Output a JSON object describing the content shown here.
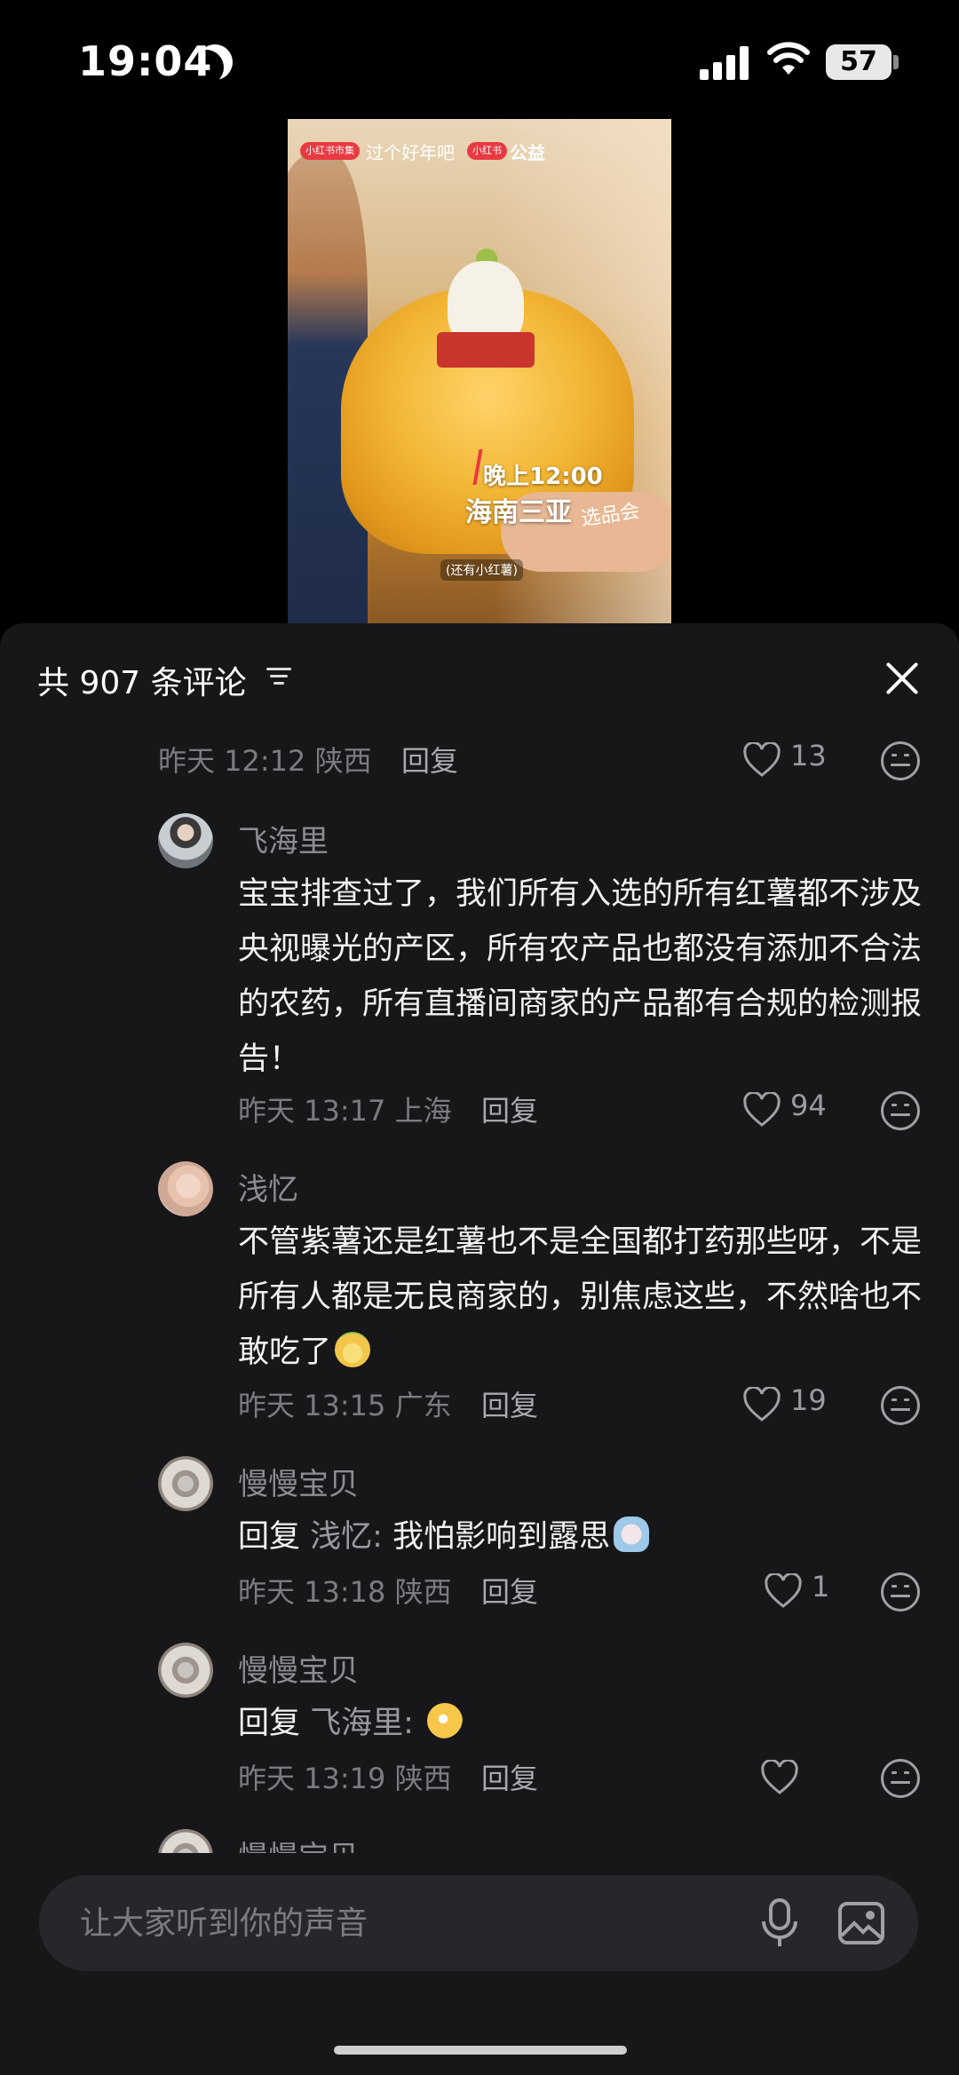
{
  "status_bar": {
    "time": "19:04",
    "battery": "57"
  },
  "video": {
    "badge_left": "小红书市集",
    "caption_left": "过个好年吧",
    "badge_mid": "小红书",
    "caption_right": "公益",
    "overlay_time": "晚上12:00",
    "overlay_place": "海南三亚",
    "overlay_event": "选品会",
    "overlay_sub": "(还有小红薯)"
  },
  "comments_panel": {
    "title": "共 907 条评论",
    "colors": {
      "background": "#17171a",
      "muted_text": "#7b7b80",
      "body_text": "#f1f1f3"
    }
  },
  "comments": [
    {
      "date": "昨天 12:12 陕西",
      "reply_label": "回复",
      "likes": "13"
    },
    {
      "user": "飞海里",
      "content": "宝宝排查过了，我们所有入选的所有红薯都不涉及央视曝光的产区，所有农产品也都没有添加不合法的农药，所有直播间商家的产品都有合规的检测报告！",
      "date": "昨天 13:17 上海",
      "reply_label": "回复",
      "likes": "94"
    },
    {
      "user": "浅忆",
      "content": "不管紫薯还是红薯也不是全国都打药那些呀，不是所有人都是无良商家的，别焦虑这些，不然啥也不敢吃了",
      "emoji": "sweet-potato-emoji",
      "date": "昨天 13:15 广东",
      "reply_label": "回复",
      "likes": "19"
    },
    {
      "user": "慢慢宝贝",
      "reply_prefix": "回复",
      "reply_to": "浅忆:",
      "content": "我怕影响到露思",
      "emoji": "crying-emoji",
      "date": "昨天 13:18 陕西",
      "reply_label": "回复",
      "likes": "1"
    },
    {
      "user": "慢慢宝贝",
      "reply_prefix": "回复",
      "reply_to": "飞海里:",
      "content": "",
      "emoji": "ok-hand-emoji",
      "date": "昨天 13:19 陕西",
      "reply_label": "回复",
      "likes": ""
    },
    {
      "user": "慢慢宝贝"
    }
  ],
  "input_bar": {
    "placeholder": "让大家听到你的声音"
  }
}
